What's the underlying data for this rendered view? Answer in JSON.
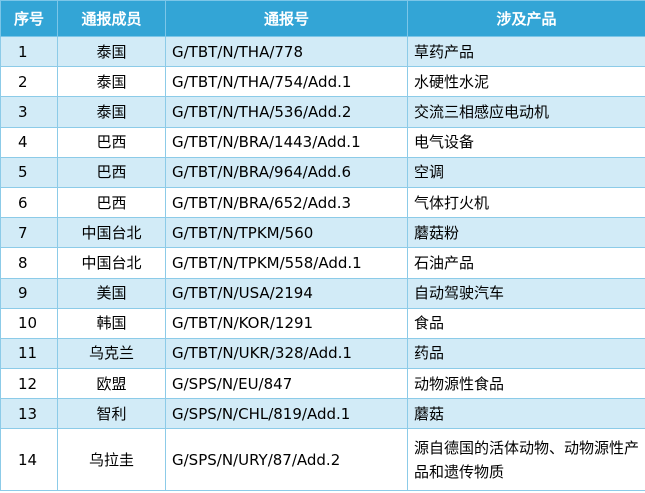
{
  "table": {
    "headers": {
      "no": "序号",
      "member": "通报成员",
      "code": "通报号",
      "product": "涉及产品"
    },
    "rows": [
      {
        "no": "1",
        "member": "泰国",
        "code": "G/TBT/N/THA/778",
        "product": "草药产品"
      },
      {
        "no": "2",
        "member": "泰国",
        "code": "G/TBT/N/THA/754/Add.1",
        "product": "水硬性水泥"
      },
      {
        "no": "3",
        "member": "泰国",
        "code": "G/TBT/N/THA/536/Add.2",
        "product": "交流三相感应电动机"
      },
      {
        "no": "4",
        "member": "巴西",
        "code": "G/TBT/N/BRA/1443/Add.1",
        "product": "电气设备"
      },
      {
        "no": "5",
        "member": "巴西",
        "code": "G/TBT/N/BRA/964/Add.6",
        "product": "空调"
      },
      {
        "no": "6",
        "member": "巴西",
        "code": "G/TBT/N/BRA/652/Add.3",
        "product": "气体打火机"
      },
      {
        "no": "7",
        "member": "中国台北",
        "code": "G/TBT/N/TPKM/560",
        "product": "蘑菇粉"
      },
      {
        "no": "8",
        "member": "中国台北",
        "code": "G/TBT/N/TPKM/558/Add.1",
        "product": "石油产品"
      },
      {
        "no": "9",
        "member": "美国",
        "code": "G/TBT/N/USA/2194",
        "product": "自动驾驶汽车"
      },
      {
        "no": "10",
        "member": "韩国",
        "code": "G/TBT/N/KOR/1291",
        "product": "食品"
      },
      {
        "no": "11",
        "member": "乌克兰",
        "code": "G/TBT/N/UKR/328/Add.1",
        "product": "药品"
      },
      {
        "no": "12",
        "member": "欧盟",
        "code": "G/SPS/N/EU/847",
        "product": "动物源性食品"
      },
      {
        "no": "13",
        "member": "智利",
        "code": "G/SPS/N/CHL/819/Add.1",
        "product": "蘑菇"
      },
      {
        "no": "14",
        "member": "乌拉圭",
        "code": "G/SPS/N/URY/87/Add.2",
        "product": "源自德国的活体动物、动物源性产品和遗传物质"
      }
    ]
  }
}
